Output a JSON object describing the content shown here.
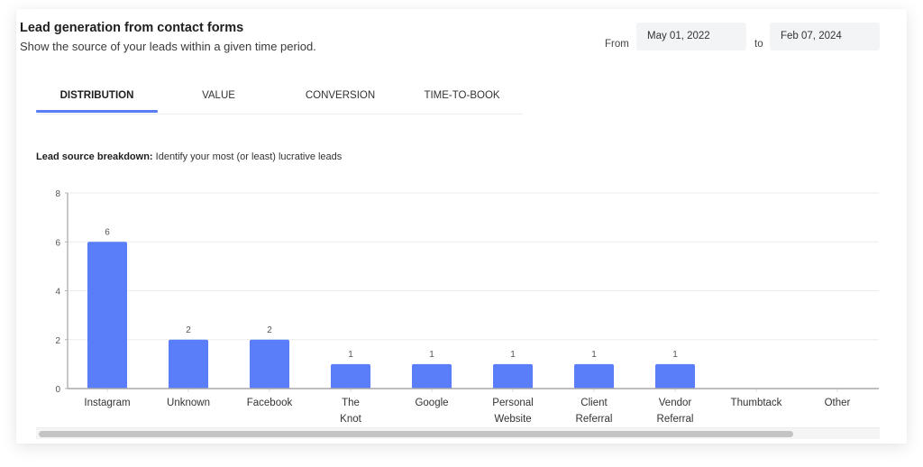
{
  "header": {
    "title": "Lead generation from contact forms",
    "subtitle": "Show the source of your leads within a given time period."
  },
  "date_range": {
    "from_label": "From",
    "from_value": "May 01, 2022",
    "to_label": "to",
    "to_value": "Feb 07, 2024"
  },
  "tabs": [
    {
      "label": "DISTRIBUTION",
      "active": true
    },
    {
      "label": "VALUE",
      "active": false
    },
    {
      "label": "CONVERSION",
      "active": false
    },
    {
      "label": "TIME-TO-BOOK",
      "active": false
    }
  ],
  "section": {
    "heading": "Lead source breakdown:",
    "description": " Identify your most (or least) lucrative leads"
  },
  "colors": {
    "accent": "#5b7cf7",
    "bar": "#5a7dfa"
  },
  "scrollbar": {
    "visible_fraction": 0.9
  },
  "chart_data": {
    "type": "bar",
    "title": "Lead source breakdown",
    "xlabel": "",
    "ylabel": "",
    "categories": [
      "Instagram",
      "Unknown",
      "Facebook",
      "The Knot",
      "Google",
      "Personal Website",
      "Client Referral",
      "Vendor Referral",
      "Thumbtack",
      "Other"
    ],
    "category_lines": [
      [
        "Instagram"
      ],
      [
        "Unknown"
      ],
      [
        "Facebook"
      ],
      [
        "The",
        "Knot"
      ],
      [
        "Google"
      ],
      [
        "Personal",
        "Website"
      ],
      [
        "Client",
        "Referral"
      ],
      [
        "Vendor",
        "Referral"
      ],
      [
        "Thumbtack"
      ],
      [
        "Other"
      ]
    ],
    "values": [
      6,
      2,
      2,
      1,
      1,
      1,
      1,
      1,
      0,
      0
    ],
    "data_labels": [
      "6",
      "2",
      "2",
      "1",
      "1",
      "1",
      "1",
      "1",
      "",
      ""
    ],
    "ylim": [
      0,
      8
    ],
    "yticks": [
      0,
      2,
      4,
      6,
      8
    ],
    "grid": true,
    "legend": "none"
  }
}
